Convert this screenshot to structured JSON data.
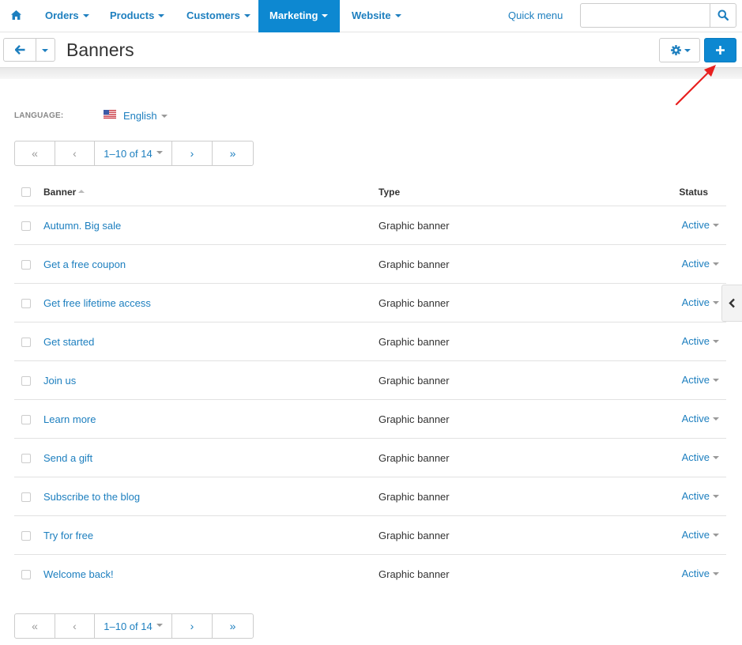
{
  "nav": {
    "items": [
      {
        "label": "Orders"
      },
      {
        "label": "Products"
      },
      {
        "label": "Customers"
      },
      {
        "label": "Marketing"
      },
      {
        "label": "Website"
      }
    ],
    "quick_menu": "Quick menu",
    "search_value": ""
  },
  "header": {
    "title": "Banners"
  },
  "language": {
    "label": "LANGUAGE:",
    "value": "English"
  },
  "pagination": {
    "first": "«",
    "prev": "‹",
    "range": "1–10 of 14",
    "next": "›",
    "last": "»"
  },
  "table": {
    "headers": {
      "banner": "Banner",
      "type": "Type",
      "status": "Status"
    },
    "rows": [
      {
        "name": "Autumn. Big sale",
        "type": "Graphic banner",
        "status": "Active"
      },
      {
        "name": "Get a free coupon",
        "type": "Graphic banner",
        "status": "Active"
      },
      {
        "name": "Get free lifetime access",
        "type": "Graphic banner",
        "status": "Active"
      },
      {
        "name": "Get started",
        "type": "Graphic banner",
        "status": "Active"
      },
      {
        "name": "Join us",
        "type": "Graphic banner",
        "status": "Active"
      },
      {
        "name": "Learn more",
        "type": "Graphic banner",
        "status": "Active"
      },
      {
        "name": "Send a gift",
        "type": "Graphic banner",
        "status": "Active"
      },
      {
        "name": "Subscribe to the blog",
        "type": "Graphic banner",
        "status": "Active"
      },
      {
        "name": "Try for free",
        "type": "Graphic banner",
        "status": "Active"
      },
      {
        "name": "Welcome back!",
        "type": "Graphic banner",
        "status": "Active"
      }
    ]
  },
  "colors": {
    "accent": "#0d88d1",
    "link": "#1d7fbf",
    "annotation": "#e8201f"
  },
  "icons": {
    "home": "home-icon",
    "search": "search-icon",
    "back": "arrow-left-icon",
    "gear": "gear-icon",
    "add": "plus-icon",
    "collapse": "chevron-left-icon"
  }
}
